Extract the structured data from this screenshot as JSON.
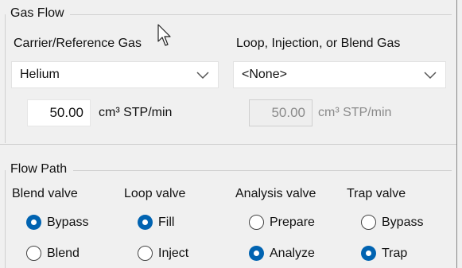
{
  "gas_flow": {
    "title": "Gas Flow",
    "carrier_label": "Carrier/Reference Gas",
    "carrier_value": "Helium",
    "loop_label": "Loop, Injection, or Blend Gas",
    "loop_value": "<None>",
    "carrier_flow_value": "50.00",
    "carrier_flow_unit": "cm³ STP/min",
    "loop_flow_value": "50.00",
    "loop_flow_unit": "cm³ STP/min"
  },
  "flow_path": {
    "title": "Flow Path",
    "columns": [
      {
        "label": "Blend valve",
        "options": [
          {
            "label": "Bypass",
            "selected": true
          },
          {
            "label": "Blend",
            "selected": false
          }
        ]
      },
      {
        "label": "Loop valve",
        "options": [
          {
            "label": "Fill",
            "selected": true
          },
          {
            "label": "Inject",
            "selected": false
          }
        ]
      },
      {
        "label": "Analysis valve",
        "options": [
          {
            "label": "Prepare",
            "selected": false
          },
          {
            "label": "Analyze",
            "selected": true
          }
        ]
      },
      {
        "label": "Trap valve",
        "options": [
          {
            "label": "Bypass",
            "selected": false
          },
          {
            "label": "Trap",
            "selected": true
          }
        ]
      }
    ]
  },
  "colors": {
    "accent": "#0063b1",
    "disabled_text": "#8a8a8a"
  }
}
